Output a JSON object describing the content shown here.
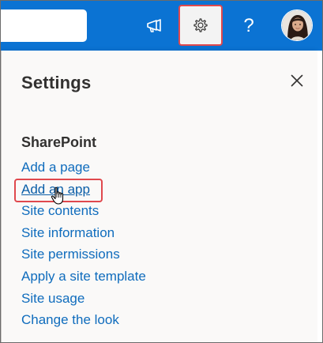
{
  "topbar": {
    "search_placeholder": "",
    "announcements_icon": "megaphone-icon",
    "settings_icon": "gear-icon",
    "help_label": "?",
    "help_icon": "question-mark-icon",
    "avatar_icon": "user-avatar",
    "brand_color": "#0b73d3"
  },
  "panel": {
    "title": "Settings",
    "close_icon": "close-icon",
    "section_title": "SharePoint",
    "links": [
      {
        "label": "Add a page"
      },
      {
        "label": "Add an app"
      },
      {
        "label": "Site contents"
      },
      {
        "label": "Site information"
      },
      {
        "label": "Site permissions"
      },
      {
        "label": "Apply a site template"
      },
      {
        "label": "Site usage"
      },
      {
        "label": "Change the look"
      }
    ],
    "link_color": "#0f6cbd",
    "highlight_color": "#e0484d"
  }
}
